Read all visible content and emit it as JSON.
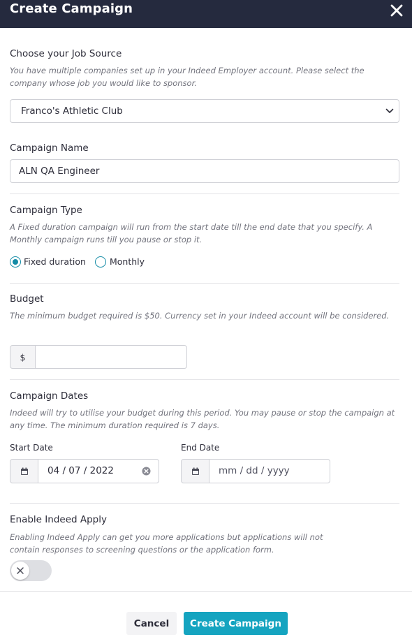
{
  "modal": {
    "title": "Create Campaign",
    "close_icon": "close-icon"
  },
  "job_source": {
    "title": "Choose your Job Source",
    "help": "You have multiple companies set up in your Indeed Employer account. Please select the company whose job you would like to sponsor.",
    "selected": "Franco's Athletic Club"
  },
  "campaign_name": {
    "title": "Campaign Name",
    "value": "ALN QA Engineer"
  },
  "campaign_type": {
    "title": "Campaign Type",
    "help": "A Fixed duration campaign will run from the start date till the end date that you specify. A Monthly campaign runs till you pause or stop it.",
    "options": [
      {
        "label": "Fixed duration",
        "selected": true
      },
      {
        "label": "Monthly",
        "selected": false
      }
    ]
  },
  "budget": {
    "title": "Budget",
    "help": "The minimum budget required is $50. Currency set in your Indeed account will be considered.",
    "currency_symbol": "$",
    "value": ""
  },
  "campaign_dates": {
    "title": "Campaign Dates",
    "help": "Indeed will try to utilise your budget during this period. You may pause or stop the campaign at any time. The minimum duration required is 7 days.",
    "start_label": "Start Date",
    "start_value": "04 / 07 / 2022",
    "end_label": "End Date",
    "end_placeholder": "mm / dd / yyyy"
  },
  "indeed_apply": {
    "title": "Enable Indeed Apply",
    "help_line1": "Enabling Indeed Apply can get you more applications but applications will not",
    "help_line2": "contain responses to screening questions or the application form.",
    "enabled": false
  },
  "footer": {
    "cancel_label": "Cancel",
    "create_label": "Create Campaign"
  },
  "colors": {
    "header_bg": "#252a3e",
    "accent": "#15a4c0",
    "radio": "#138ba6"
  }
}
